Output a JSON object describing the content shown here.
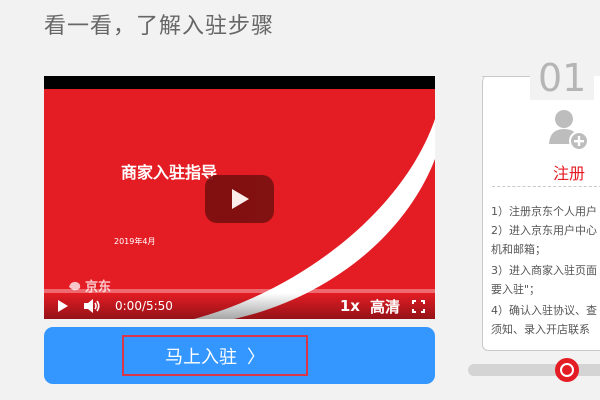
{
  "section_title": "看一看，了解入驻步骤",
  "video": {
    "title": "商家入驻指导",
    "date": "2019年4月",
    "watermark": "京东",
    "time": "0:00/5:50",
    "speed": "1x",
    "quality": "高清"
  },
  "join_button": {
    "label": "马上入驻",
    "chevron": "〉"
  },
  "step": {
    "number": "01",
    "label": "注册",
    "lines": [
      "1）注册京东个人用户",
      "2）进入京东用户中心",
      "机和邮箱；",
      "3）进入商家入驻页面",
      "要入驻\"；",
      "4）确认入驻协议、查",
      "须知、录入开店联系"
    ]
  },
  "colors": {
    "brand_red": "#e41c24",
    "button_blue": "#3497ff",
    "highlight_border": "#d9364a"
  },
  "icons": {
    "play": "play-icon",
    "volume": "volume-icon",
    "fullscreen": "fullscreen-icon",
    "user_add": "user-add-icon"
  }
}
